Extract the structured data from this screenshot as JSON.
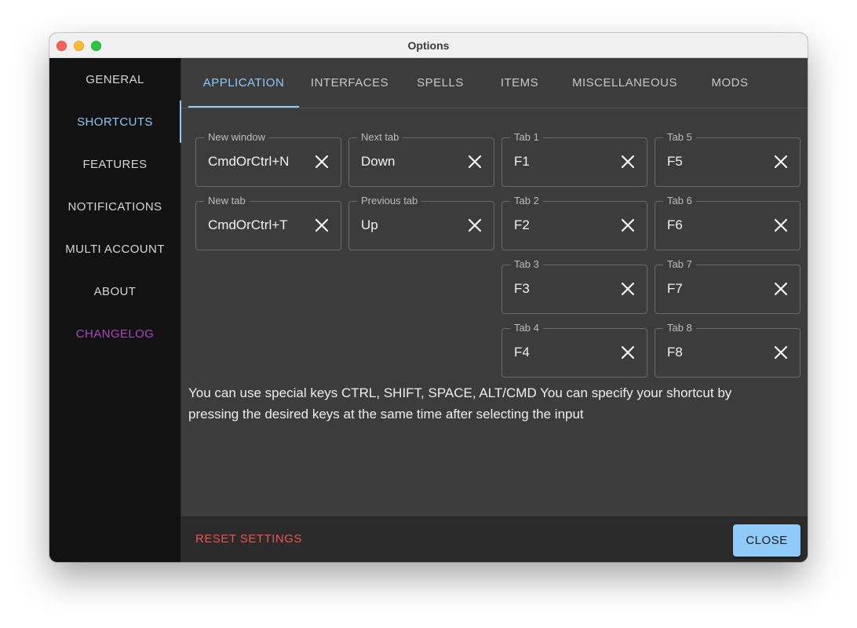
{
  "window": {
    "title": "Options"
  },
  "sidebar": {
    "items": [
      {
        "label": "GENERAL"
      },
      {
        "label": "SHORTCUTS"
      },
      {
        "label": "FEATURES"
      },
      {
        "label": "NOTIFICATIONS"
      },
      {
        "label": "MULTI ACCOUNT"
      },
      {
        "label": "ABOUT"
      },
      {
        "label": "CHANGELOG"
      }
    ],
    "active": "SHORTCUTS"
  },
  "tabs": {
    "items": [
      {
        "label": "APPLICATION"
      },
      {
        "label": "INTERFACES"
      },
      {
        "label": "SPELLS"
      },
      {
        "label": "ITEMS"
      },
      {
        "label": "MISCELLANEOUS"
      },
      {
        "label": "MODS"
      }
    ],
    "active": "APPLICATION"
  },
  "shortcuts": {
    "new_window": {
      "label": "New window",
      "value": "CmdOrCtrl+N"
    },
    "new_tab": {
      "label": "New tab",
      "value": "CmdOrCtrl+T"
    },
    "next_tab": {
      "label": "Next tab",
      "value": "Down"
    },
    "previous_tab": {
      "label": "Previous tab",
      "value": "Up"
    },
    "tab1": {
      "label": "Tab 1",
      "value": "F1"
    },
    "tab2": {
      "label": "Tab 2",
      "value": "F2"
    },
    "tab3": {
      "label": "Tab 3",
      "value": "F3"
    },
    "tab4": {
      "label": "Tab 4",
      "value": "F4"
    },
    "tab5": {
      "label": "Tab 5",
      "value": "F5"
    },
    "tab6": {
      "label": "Tab 6",
      "value": "F6"
    },
    "tab7": {
      "label": "Tab 7",
      "value": "F7"
    },
    "tab8": {
      "label": "Tab 8",
      "value": "F8"
    }
  },
  "hint": "You can use special keys CTRL, SHIFT, SPACE, ALT/CMD You can specify your shortcut by pressing the desired keys at the same time after selecting the input",
  "footer": {
    "reset_label": "RESET SETTINGS",
    "close_label": "CLOSE"
  },
  "colors": {
    "accent": "#90caf9",
    "danger": "#ef5350",
    "changelog": "#ab47bc"
  },
  "icons": {
    "clear": "close-icon"
  }
}
